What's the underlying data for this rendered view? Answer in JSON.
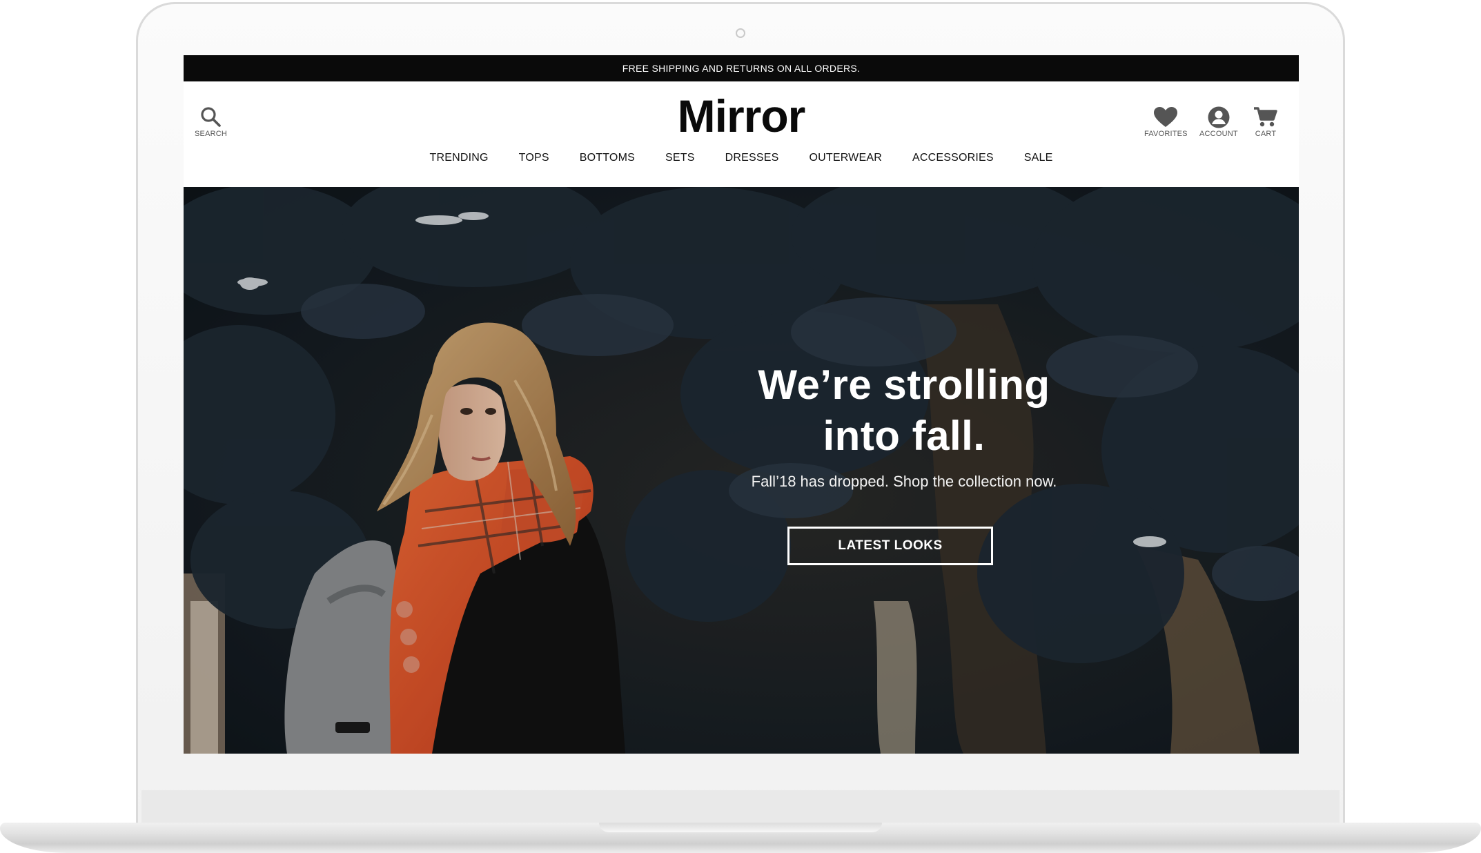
{
  "promo": {
    "text": "FREE SHIPPING AND RETURNS ON ALL ORDERS."
  },
  "header": {
    "search_label": "SEARCH",
    "logo": "Mirror",
    "favorites_label": "FAVORITES",
    "account_label": "ACCOUNT",
    "cart_label": "CART"
  },
  "nav": {
    "items": [
      {
        "label": "TRENDING"
      },
      {
        "label": "TOPS"
      },
      {
        "label": "BOTTOMS"
      },
      {
        "label": "SETS"
      },
      {
        "label": "DRESSES"
      },
      {
        "label": "OUTERWEAR"
      },
      {
        "label": "ACCESSORIES"
      },
      {
        "label": "SALE"
      }
    ]
  },
  "hero": {
    "heading_line1": "We’re strolling",
    "heading_line2": "into fall.",
    "subtitle": "Fall’18 has dropped. Shop the collection now.",
    "button_label": "LATEST LOOKS"
  },
  "icons": {
    "search": "search-icon",
    "favorites": "heart-icon",
    "account": "user-circle-icon",
    "cart": "cart-icon"
  },
  "colors": {
    "promo_bar": "#0a0a0a",
    "scarf": "#e4532a",
    "foliage": "#1b2530"
  }
}
